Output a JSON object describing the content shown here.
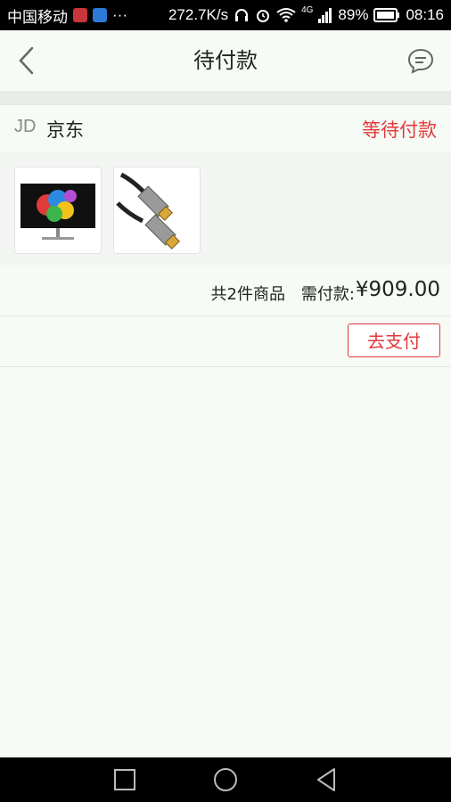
{
  "status_bar": {
    "carrier": "中国移动",
    "dots": "···",
    "network_speed": "272.7K/s",
    "signal": "4G",
    "battery": "89%",
    "time": "08:16"
  },
  "header": {
    "title": "待付款"
  },
  "order": {
    "store_logo": "JD",
    "store_name": "京东",
    "status": "等待付款",
    "items_count_text": "共2件商品",
    "pay_label": "需付款:",
    "pay_amount": "¥909.00",
    "products": [
      {
        "name": "monitor"
      },
      {
        "name": "hdmi-cable"
      }
    ]
  },
  "actions": {
    "pay_button": "去支付"
  },
  "colors": {
    "accent": "#e4393c",
    "background": "#f6fbf5"
  }
}
